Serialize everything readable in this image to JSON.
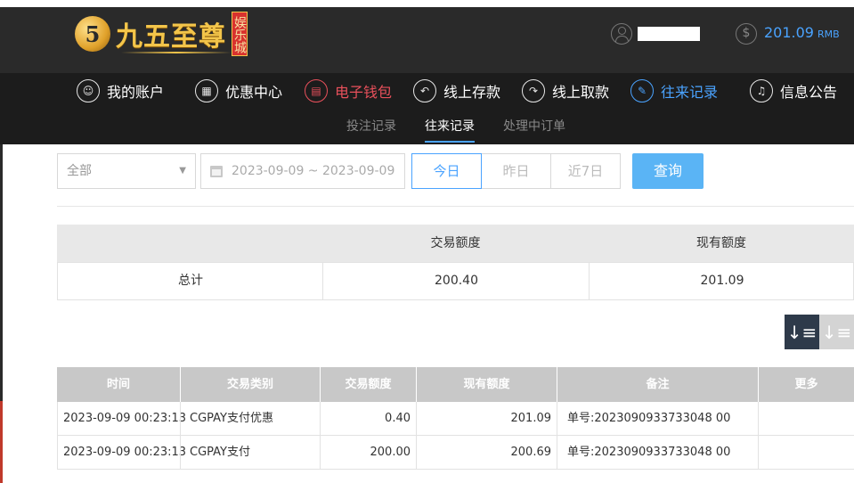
{
  "brand": {
    "logo_char": "5",
    "name": "九五至尊",
    "badge": "娱乐城"
  },
  "account": {
    "balance": "201.09",
    "currency": "RMB"
  },
  "nav": {
    "items": [
      {
        "label": "我的账户",
        "icon": "user-icon"
      },
      {
        "label": "优惠中心",
        "icon": "gift-icon"
      },
      {
        "label": "电子钱包",
        "icon": "wallet-icon"
      },
      {
        "label": "线上存款",
        "icon": "deposit-icon"
      },
      {
        "label": "线上取款",
        "icon": "withdraw-icon"
      },
      {
        "label": "往来记录",
        "icon": "records-icon"
      },
      {
        "label": "信息公告",
        "icon": "bell-icon"
      }
    ]
  },
  "subnav": {
    "items": [
      "投注记录",
      "往来记录",
      "处理中订单"
    ]
  },
  "filters": {
    "type_selected": "全部",
    "date_range": "2023-09-09 ~ 2023-09-09",
    "quick": [
      "今日",
      "昨日",
      "近7日"
    ],
    "query_label": "查询"
  },
  "summary": {
    "headers": [
      "",
      "交易额度",
      "现有额度"
    ],
    "row": [
      "总计",
      "200.40",
      "201.09"
    ]
  },
  "records": {
    "headers": [
      "时间",
      "交易类别",
      "交易额度",
      "现有额度",
      "备注",
      "更多"
    ],
    "rows": [
      [
        "2023-09-09 00:23:13",
        "CGPAY支付优惠",
        "0.40",
        "201.09",
        "单号:2023090933733048 00",
        ""
      ],
      [
        "2023-09-09 00:23:13",
        "CGPAY支付",
        "200.00",
        "200.69",
        "单号:2023090933733048 00",
        ""
      ]
    ]
  },
  "colors": {
    "accent_blue": "#4aa3ff",
    "accent_red": "#e8505b",
    "gold": "#f3c54a"
  }
}
